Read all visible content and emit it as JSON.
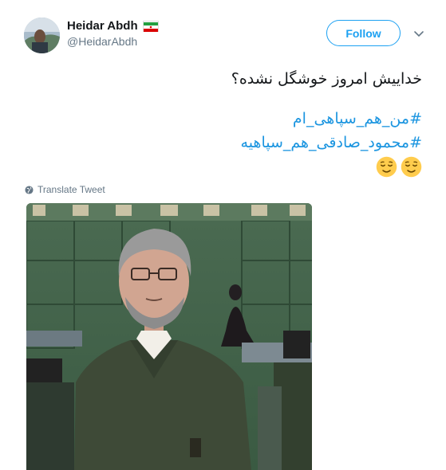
{
  "user": {
    "display_name": "Heidar Abdh",
    "handle": "@HeidarAbdh",
    "flag_icon": "iran-flag-icon"
  },
  "follow": {
    "label": "Follow"
  },
  "tweet": {
    "text": "خداییش امروز خوشگل نشده؟",
    "hashtags": [
      "#من_هم_سپاهی_ام",
      "#محمود_صادقی_هم_سپاهیه"
    ],
    "emojis": [
      "relieved-face-icon",
      "relieved-face-icon"
    ]
  },
  "translate": {
    "label": "Translate Tweet"
  },
  "colors": {
    "accent": "#1da1f2",
    "hashtag": "#1b95e0",
    "muted": "#657786"
  }
}
